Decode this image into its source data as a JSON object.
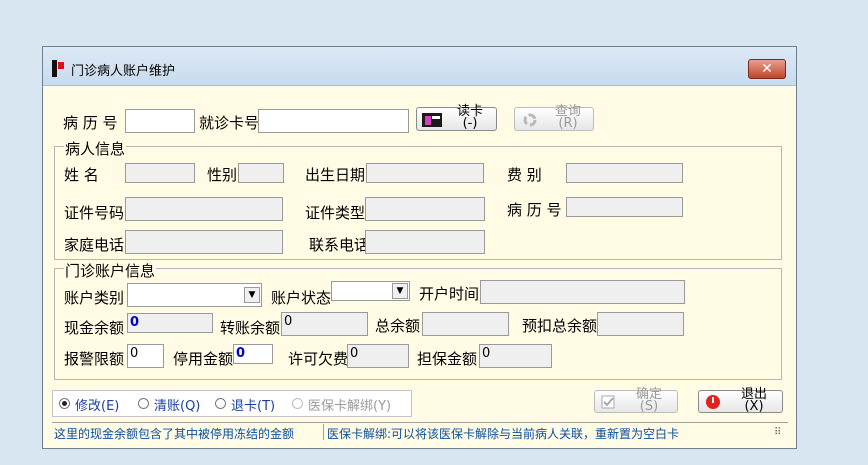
{
  "window": {
    "title": "门诊病人账户维护",
    "close_label": "✕"
  },
  "search": {
    "record_label": "病 历 号",
    "card_label": "就诊卡号",
    "read_card": {
      "label": "读卡",
      "key": "(-)"
    },
    "query": {
      "label": "查询",
      "key": "(R)"
    }
  },
  "patient": {
    "legend": "病人信息",
    "name_label": "姓    名",
    "gender_label": "性别",
    "birth_label": "出生日期",
    "fee_label": "费    别",
    "id_no_label": "证件号码",
    "id_type_label": "证件类型",
    "record_label": "病 历 号",
    "home_phone_label": "家庭电话",
    "contact_phone_label": "联系电话"
  },
  "account": {
    "legend": "门诊账户信息",
    "type_label": "账户类别",
    "status_label": "账户状态",
    "open_time_label": "开户时间",
    "cash_balance_label": "现金余额",
    "cash_balance": "0",
    "transfer_balance_label": "转账余额",
    "transfer_balance": "0",
    "total_balance_label": "总余额",
    "prepaid_label": "预扣总余额",
    "alarm_label": "报警限额",
    "alarm_value": "0",
    "suspend_label": "停用金额",
    "suspend_value": "0",
    "credit_label": "许可欠费",
    "credit_value": "0",
    "guarantee_label": "担保金额",
    "guarantee_value": "0"
  },
  "modes": [
    {
      "label": "修改(E)",
      "selected": true,
      "disabled": false
    },
    {
      "label": "清账(Q)",
      "selected": false,
      "disabled": false
    },
    {
      "label": "退卡(T)",
      "selected": false,
      "disabled": false
    },
    {
      "label": "医保卡解绑(Y)",
      "selected": false,
      "disabled": true
    }
  ],
  "actions": {
    "confirm": {
      "label": "确定",
      "key": "(S)"
    },
    "exit": {
      "label": "退出",
      "key": "(X)"
    }
  },
  "status": {
    "left": "这里的现金余额包含了其中被停用冻结的金额",
    "right": "医保卡解绑:可以将该医保卡解除与当前病人关联，重新置为空白卡"
  }
}
